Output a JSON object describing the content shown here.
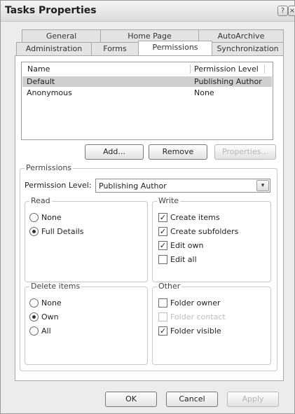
{
  "window": {
    "title": "Tasks Properties",
    "help_glyph": "?",
    "close_glyph": "×"
  },
  "tabs": {
    "back": [
      "General",
      "Home Page",
      "AutoArchive"
    ],
    "front": [
      "Administration",
      "Forms",
      "Permissions",
      "Synchronization"
    ],
    "active": "Permissions"
  },
  "permissions_list": {
    "headers": {
      "name": "Name",
      "level": "Permission Level"
    },
    "rows": [
      {
        "name": "Default",
        "level": "Publishing Author",
        "selected": true
      },
      {
        "name": "Anonymous",
        "level": "None",
        "selected": false
      }
    ]
  },
  "list_buttons": {
    "add": "Add...",
    "remove": "Remove",
    "properties": "Properties..."
  },
  "permissions_group": {
    "title": "Permissions",
    "level_label": "Permission Level:",
    "level_value": "Publishing Author",
    "dropdown_glyph": "▾"
  },
  "read": {
    "title": "Read",
    "options": [
      {
        "label": "None",
        "checked": false
      },
      {
        "label": "Full Details",
        "checked": true
      }
    ]
  },
  "write": {
    "title": "Write",
    "options": [
      {
        "label": "Create items",
        "checked": true
      },
      {
        "label": "Create subfolders",
        "checked": true
      },
      {
        "label": "Edit own",
        "checked": true
      },
      {
        "label": "Edit all",
        "checked": false
      }
    ]
  },
  "delete_items": {
    "title": "Delete items",
    "options": [
      {
        "label": "None",
        "checked": false
      },
      {
        "label": "Own",
        "checked": true
      },
      {
        "label": "All",
        "checked": false
      }
    ]
  },
  "other": {
    "title": "Other",
    "options": [
      {
        "label": "Folder owner",
        "checked": false,
        "enabled": true
      },
      {
        "label": "Folder contact",
        "checked": false,
        "enabled": false
      },
      {
        "label": "Folder visible",
        "checked": true,
        "enabled": true
      }
    ]
  },
  "footer": {
    "ok": "OK",
    "cancel": "Cancel",
    "apply": "Apply"
  },
  "check_glyph": "✓"
}
